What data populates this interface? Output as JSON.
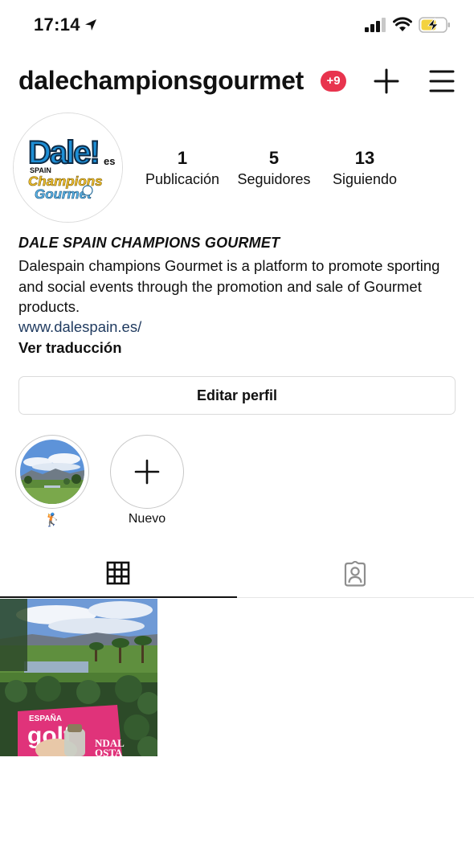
{
  "status_bar": {
    "time": "17:14",
    "icons": [
      "location-arrow-icon",
      "signal-icon",
      "wifi-icon",
      "battery-charging-icon"
    ]
  },
  "header": {
    "username": "dalechampionsgourmet",
    "notification_badge": "+9",
    "icons": [
      "plus-icon",
      "menu-icon"
    ]
  },
  "profile": {
    "avatar_logo": {
      "line1": "Dale!",
      "suffix": "es",
      "line2": "SPAIN",
      "line3": "Champions",
      "line4": "Gourmet"
    },
    "stats": [
      {
        "count": "1",
        "label": "Publicación"
      },
      {
        "count": "5",
        "label": "Seguidores"
      },
      {
        "count": "13",
        "label": "Siguiendo"
      }
    ],
    "bio_name": "DALE SPAIN CHAMPIONS GOURMET",
    "bio_text": "Dalespain champions Gourmet is a platform to promote sporting and social events through the promotion and sale of Gourmet products.",
    "bio_link": "www.dalespain.es/",
    "translate_label": "Ver traducción"
  },
  "edit_profile_label": "Editar perfil",
  "highlights": [
    {
      "label": "🏌️",
      "type": "photo"
    },
    {
      "label": "Nuevo",
      "type": "new",
      "icon": "plus-icon"
    }
  ],
  "tabs": [
    {
      "name": "grid",
      "icon": "grid-icon",
      "active": true
    },
    {
      "name": "tagged",
      "icon": "tagged-person-icon",
      "active": false
    }
  ],
  "posts": [
    {
      "overlay_text_1": "ESPAÑA",
      "overlay_text_2": "golf",
      "overlay_text_3": "NDAL",
      "overlay_text_4": "OSTA"
    }
  ],
  "colors": {
    "badge": "#e8344e",
    "link": "#1f3a5f",
    "border": "#dbdbdb",
    "magazine_pink": "#e0337a"
  }
}
